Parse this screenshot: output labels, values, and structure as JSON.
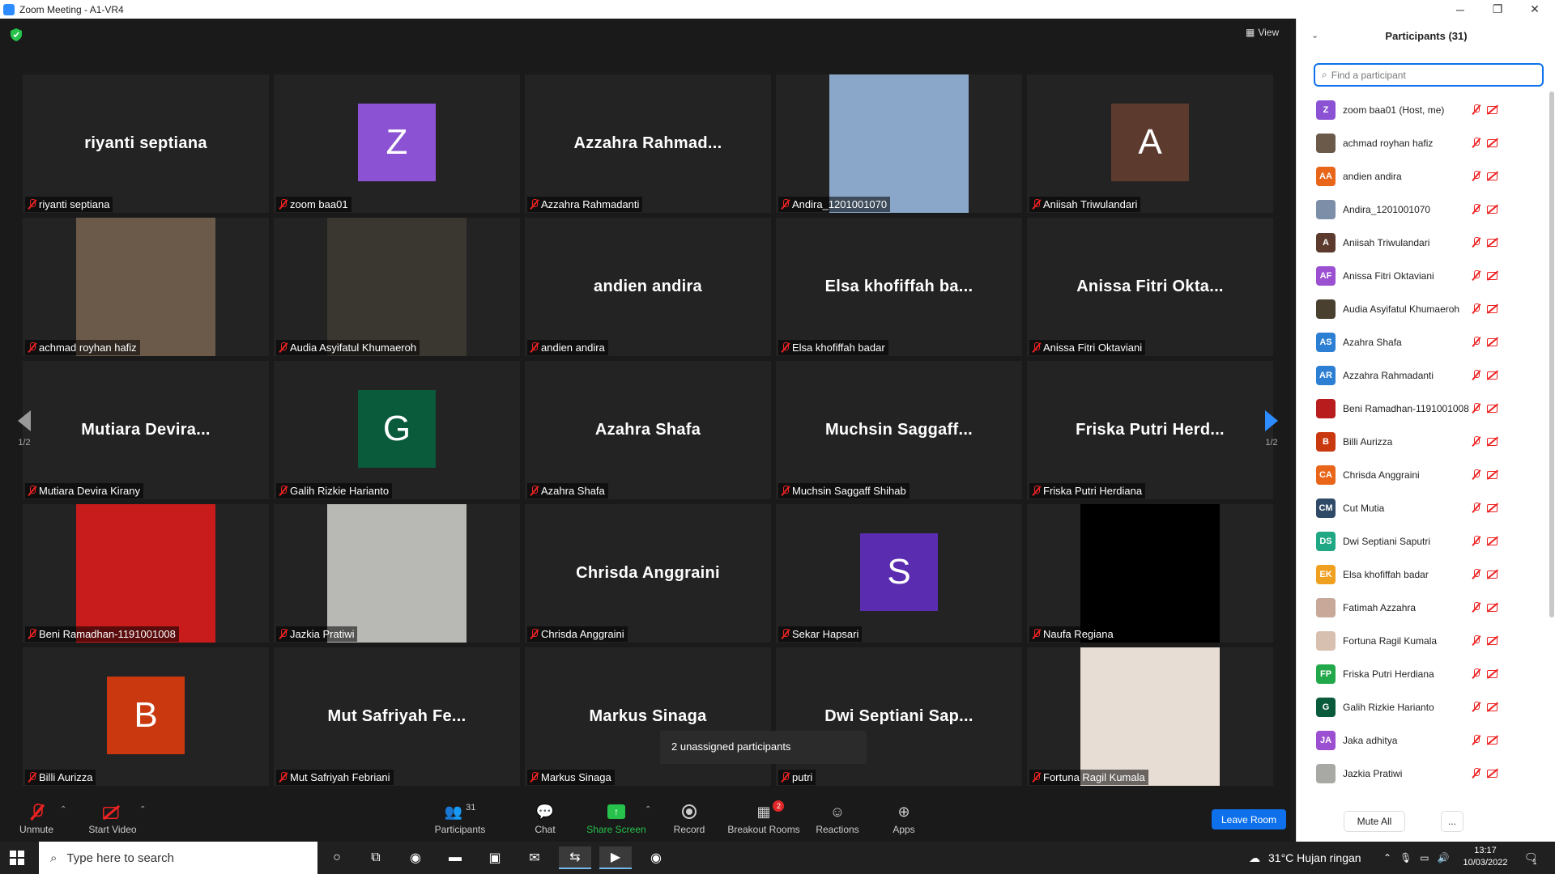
{
  "window": {
    "title": "Zoom Meeting - A1-VR4",
    "minimize": "─",
    "maximize": "❐",
    "close": "✕"
  },
  "meeting": {
    "view_label": "View",
    "pager_label": "1/2",
    "popup_text": "2 unassigned participants",
    "tiles": [
      {
        "label": "riyanti septiana",
        "display": "riyanti septiana",
        "kind": "name"
      },
      {
        "label": "zoom baa01",
        "display": "Z",
        "kind": "avatar",
        "color": "#8b53d4"
      },
      {
        "label": "Azzahra Rahmadanti",
        "display": "Azzahra  Rahmad...",
        "kind": "name"
      },
      {
        "label": "Andira_1201001070",
        "display": "",
        "kind": "photo",
        "color": "#8aa6c8"
      },
      {
        "label": "Aniisah Triwulandari",
        "display": "A",
        "kind": "avatar",
        "color": "#5c3b2e"
      },
      {
        "label": "achmad royhan hafiz",
        "display": "",
        "kind": "photo",
        "color": "#6b5a4a"
      },
      {
        "label": "Audia Asyifatul Khumaeroh",
        "display": "",
        "kind": "photo",
        "color": "#3a3630"
      },
      {
        "label": "andien andira",
        "display": "andien andira",
        "kind": "name"
      },
      {
        "label": "Elsa khofiffah badar",
        "display": "Elsa  khofiffah  ba...",
        "kind": "name"
      },
      {
        "label": "Anissa Fitri Oktaviani",
        "display": "Anissa  Fitri  Okta...",
        "kind": "name"
      },
      {
        "label": "Mutiara Devira Kirany",
        "display": "Mutiara  Devira...",
        "kind": "name"
      },
      {
        "label": "Galih Rizkie Harianto",
        "display": "G",
        "kind": "avatar",
        "color": "#0a5a3c"
      },
      {
        "label": "Azahra Shafa",
        "display": "Azahra Shafa",
        "kind": "name"
      },
      {
        "label": "Muchsin Saggaff Shihab",
        "display": "Muchsin  Saggaff...",
        "kind": "name"
      },
      {
        "label": "Friska Putri Herdiana",
        "display": "Friska  Putri  Herd...",
        "kind": "name"
      },
      {
        "label": "Beni Ramadhan-1191001008",
        "display": "",
        "kind": "photo",
        "color": "#c81c1c"
      },
      {
        "label": "Jazkia Pratiwi",
        "display": "",
        "kind": "photo",
        "color": "#b8b8b4"
      },
      {
        "label": "Chrisda Anggraini",
        "display": "Chrisda Anggraini",
        "kind": "name"
      },
      {
        "label": "Sekar Hapsari",
        "display": "S",
        "kind": "avatar",
        "color": "#5a2db0"
      },
      {
        "label": "Naufa Regiana",
        "display": "",
        "kind": "photo",
        "color": "#000000"
      },
      {
        "label": "Billi Aurizza",
        "display": "B",
        "kind": "avatar",
        "color": "#c9380f"
      },
      {
        "label": "Mut Safriyah Febriani",
        "display": "Mut  Safriyah  Fe...",
        "kind": "name"
      },
      {
        "label": "Markus Sinaga",
        "display": "Markus Sinaga",
        "kind": "name"
      },
      {
        "label": "putri",
        "display": "Dwi  Septiani  Sap...",
        "kind": "name"
      },
      {
        "label": "Fortuna Ragil Kumala",
        "display": "",
        "kind": "photo",
        "color": "#e8ddd4"
      }
    ]
  },
  "toolbar": {
    "unmute": "Unmute",
    "start_video": "Start Video",
    "participants": "Participants",
    "participants_count": "31",
    "chat": "Chat",
    "share_screen": "Share Screen",
    "record": "Record",
    "breakout_rooms": "Breakout Rooms",
    "breakout_badge": "2",
    "reactions": "Reactions",
    "apps": "Apps",
    "leave_room": "Leave Room"
  },
  "panel": {
    "title": "Participants (31)",
    "search_placeholder": "Find a participant",
    "mute_all": "Mute All",
    "more": "...",
    "participants": [
      {
        "name": "zoom baa01 (Host, me)",
        "initials": "Z",
        "color": "#8b53d4"
      },
      {
        "name": "achmad royhan hafiz",
        "initials": "",
        "color": "#6b5a4a"
      },
      {
        "name": "andien andira",
        "initials": "AA",
        "color": "#e8651a"
      },
      {
        "name": "Andira_1201001070",
        "initials": "",
        "color": "#7d8ea8"
      },
      {
        "name": "Aniisah Triwulandari",
        "initials": "A",
        "color": "#5c3b2e"
      },
      {
        "name": "Anissa Fitri Oktaviani",
        "initials": "AF",
        "color": "#9b4fd1"
      },
      {
        "name": "Audia Asyifatul Khumaeroh",
        "initials": "",
        "color": "#4a4030"
      },
      {
        "name": "Azahra Shafa",
        "initials": "AS",
        "color": "#2d7fd3"
      },
      {
        "name": "Azzahra Rahmadanti",
        "initials": "AR",
        "color": "#2d7fd3"
      },
      {
        "name": "Beni Ramadhan-1191001008",
        "initials": "",
        "color": "#b81c1c"
      },
      {
        "name": "Billi Aurizza",
        "initials": "B",
        "color": "#c9380f"
      },
      {
        "name": "Chrisda Anggraini",
        "initials": "CA",
        "color": "#e8651a"
      },
      {
        "name": "Cut Mutia",
        "initials": "CM",
        "color": "#2e4a66"
      },
      {
        "name": "Dwi Septiani Saputri",
        "initials": "DS",
        "color": "#20a884"
      },
      {
        "name": "Elsa khofiffah badar",
        "initials": "EK",
        "color": "#f0a020"
      },
      {
        "name": "Fatimah Azzahra",
        "initials": "",
        "color": "#c8a898"
      },
      {
        "name": "Fortuna Ragil Kumala",
        "initials": "",
        "color": "#d8c0b0"
      },
      {
        "name": "Friska Putri Herdiana",
        "initials": "FP",
        "color": "#22a84a"
      },
      {
        "name": "Galih Rizkie Harianto",
        "initials": "G",
        "color": "#0a5a3c"
      },
      {
        "name": "Jaka adhitya",
        "initials": "JA",
        "color": "#9b4fd1"
      },
      {
        "name": "Jazkia Pratiwi",
        "initials": "",
        "color": "#a8a8a4"
      }
    ]
  },
  "taskbar": {
    "search_placeholder": "Type here to search",
    "weather": "31°C  Hujan ringan",
    "time": "13:17",
    "date": "10/03/2022",
    "notifications": "1"
  }
}
